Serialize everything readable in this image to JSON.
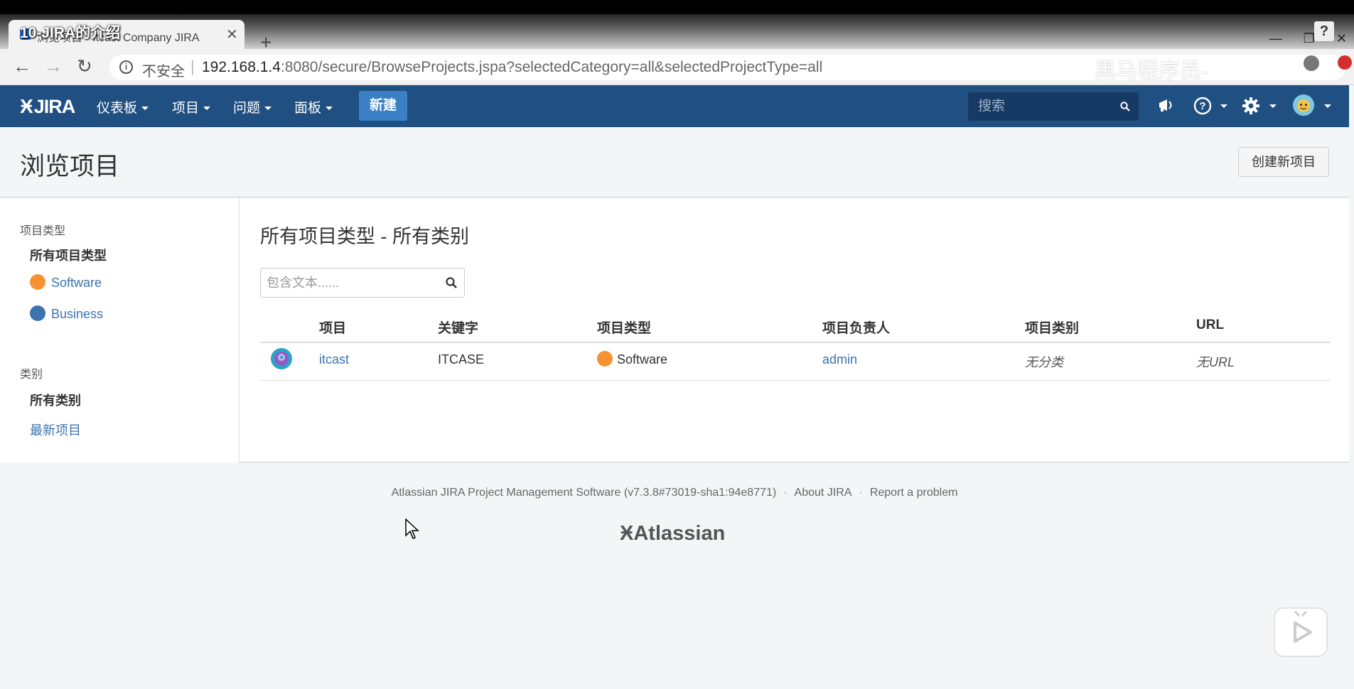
{
  "browser": {
    "video_title": "10-JIRA的介绍",
    "tab_title": "浏览项目 - Itcast Company JIRA",
    "tab_close": "✕",
    "new_tab": "+",
    "not_secure": "不安全",
    "url_sep": "|",
    "url_host": "192.168.1.4",
    "url_rest": ":8080/secure/BrowseProjects.jspa?selectedCategory=all&selectedProjectType=all",
    "watermark": "黑马程序员-",
    "win_minimize": "—",
    "win_restore": "❐",
    "win_close": "✕",
    "win_help": "?",
    "back": "←",
    "forward": "→",
    "reload": "↻"
  },
  "header": {
    "logo": "JIRA",
    "logo_mark": "Ӿ",
    "nav": [
      "仪表板",
      "项目",
      "问题",
      "面板"
    ],
    "create": "新建",
    "search_placeholder": "搜索"
  },
  "page": {
    "title": "浏览项目",
    "create_project": "创建新项目"
  },
  "sidebar": {
    "type_heading": "项目类型",
    "all_types": "所有项目类型",
    "software": "Software",
    "business": "Business",
    "category_heading": "类别",
    "all_categories": "所有类别",
    "recent": "最新项目"
  },
  "main": {
    "title": "所有项目类型 - 所有类别",
    "filter_placeholder": "包含文本......",
    "columns": [
      "项目",
      "关键字",
      "项目类型",
      "项目负责人",
      "项目类别",
      "URL"
    ],
    "rows": [
      {
        "project": "itcast",
        "key": "ITCASE",
        "type": "Software",
        "lead": "admin",
        "category": "无分类",
        "url": "无URL"
      }
    ]
  },
  "footer": {
    "product": "Atlassian JIRA Project Management Software (v7.3.8#73019-sha1:94e8771)",
    "sep": "·",
    "about": "About JIRA",
    "report": "Report a problem",
    "atlassian": "Atlassian",
    "atlassian_mark": "Ӿ"
  },
  "colors": {
    "header_bg": "#205081",
    "create_btn": "#3b7fc4",
    "link": "#3b73af",
    "software_icon": "#f79232",
    "business_icon": "#3b73af"
  }
}
